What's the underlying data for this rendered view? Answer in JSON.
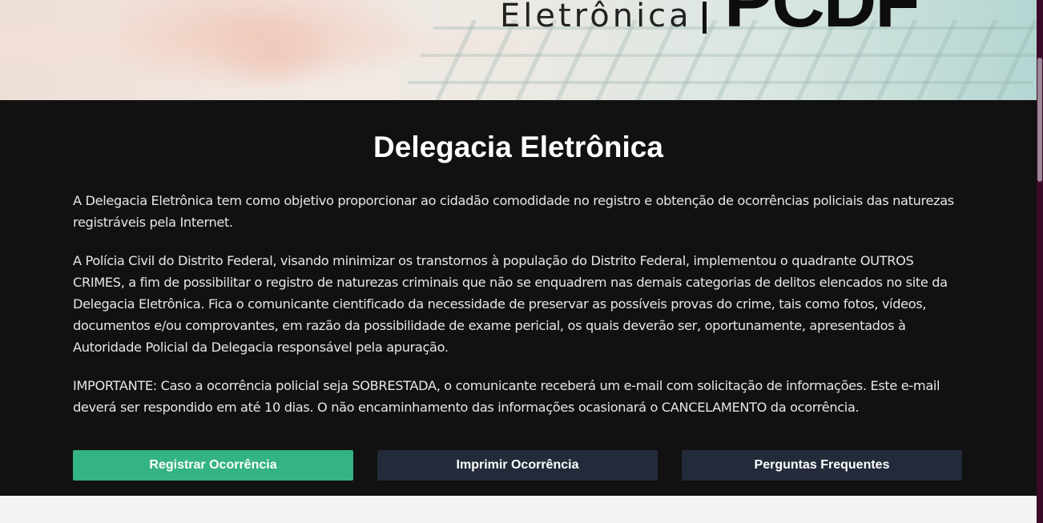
{
  "header": {
    "brand_text": "Eletrônica",
    "brand_logo": "PCDF"
  },
  "main": {
    "title": "Delegacia Eletrônica",
    "paragraphs": [
      "A Delegacia Eletrônica tem como objetivo proporcionar ao cidadão comodidade no registro e obtenção de ocorrências policiais das naturezas registráveis pela Internet.",
      "A Polícia Civil do Distrito Federal, visando minimizar os transtornos à população do Distrito Federal, implementou o quadrante OUTROS CRIMES, a fim de possibilitar o registro de naturezas criminais que não se enquadrem nas demais categorias de delitos elencados no site da Delegacia Eletrônica. Fica o comunicante cientificado da necessidade de preservar as possíveis provas do crime, tais como fotos, vídeos, documentos e/ou comprovantes, em razão da possibilidade de exame pericial, os quais deverão ser, oportunamente, apresentados à Autoridade Policial da Delegacia responsável pela apuração.",
      "IMPORTANTE: Caso a ocorrência policial seja SOBRESTADA, o comunicante receberá um e-mail com solicitação de informações. Este e-mail deverá ser respondido em até 10 dias. O não encaminhamento das informações ocasionará o CANCELAMENTO da ocorrência."
    ],
    "buttons": {
      "register": "Registrar Ocorrência",
      "print": "Imprimir Ocorrência",
      "faq": "Perguntas Frequentes"
    }
  },
  "colors": {
    "panel_bg": "#111111",
    "primary_button": "#34b383",
    "secondary_button": "#232b3a",
    "scrollbar_track": "#3b0a2b"
  }
}
